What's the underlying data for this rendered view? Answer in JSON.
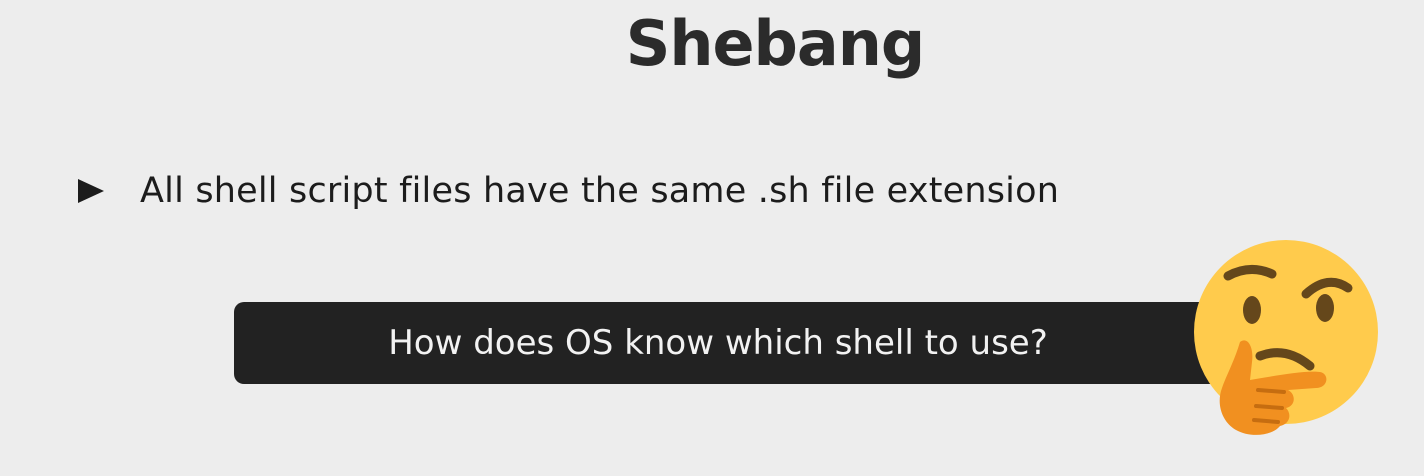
{
  "slide": {
    "title": "Shebang",
    "bullets": [
      "All shell script files have the same .sh file extension"
    ],
    "question": "How does OS know which shell to use?",
    "emoji": "thinking-face-icon",
    "colors": {
      "background": "#ededed",
      "title_text": "#2b2b2b",
      "body_text": "#1c1c1c",
      "question_box": "#222222",
      "question_text": "#f2f2f2",
      "emoji_face": "#ffcb4c",
      "emoji_hand": "#f19020",
      "emoji_features": "#65471b"
    }
  }
}
